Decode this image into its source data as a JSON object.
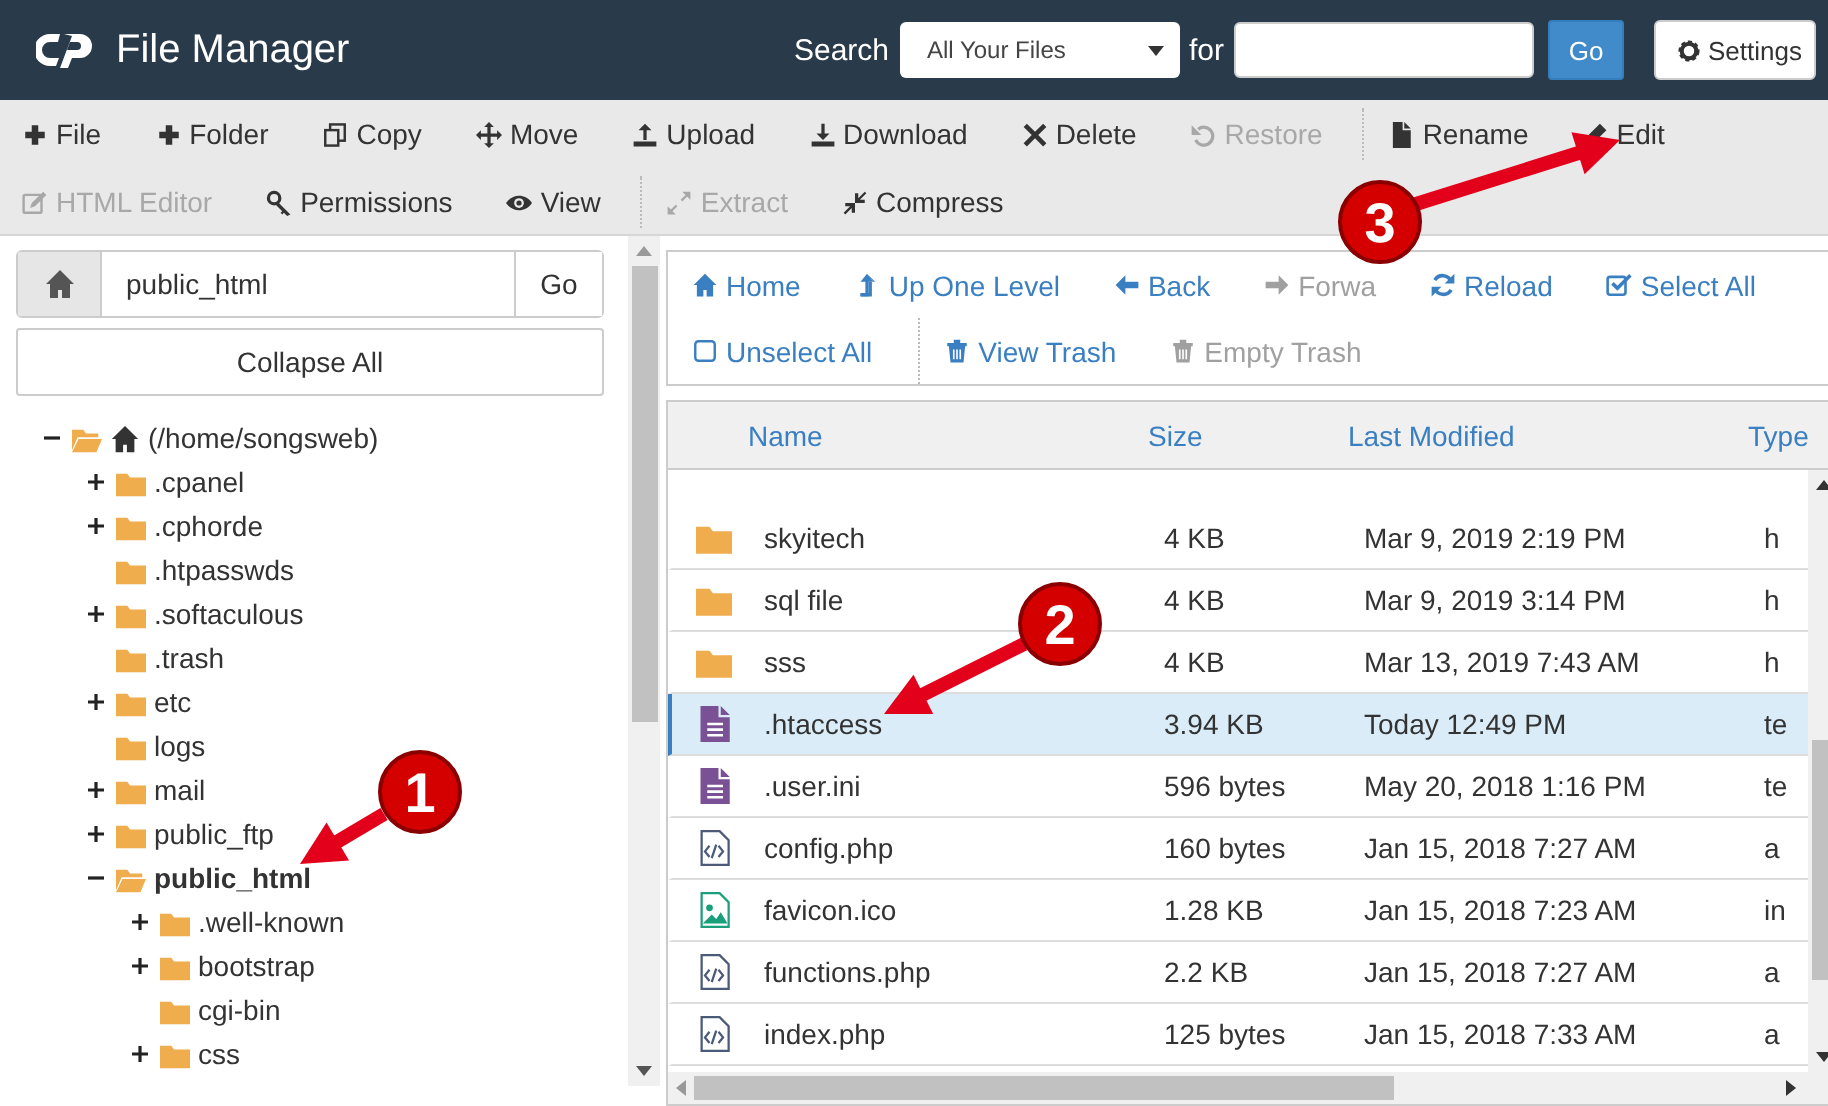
{
  "header": {
    "title": "File Manager",
    "search_label": "Search",
    "search_scope": "All Your Files",
    "for_label": "for",
    "go": "Go",
    "settings": "Settings"
  },
  "toolbar": [
    [
      {
        "label": "File",
        "kind": "plus",
        "disabled": false
      },
      {
        "label": "Folder",
        "kind": "plus",
        "disabled": false
      },
      {
        "label": "Copy",
        "kind": "copy",
        "disabled": false
      },
      {
        "label": "Move",
        "kind": "move",
        "disabled": false
      },
      {
        "label": "Upload",
        "kind": "upload",
        "disabled": false
      },
      {
        "label": "Download",
        "kind": "download",
        "disabled": false
      },
      {
        "label": "Delete",
        "kind": "delete",
        "disabled": false
      },
      {
        "label": "Restore",
        "kind": "restore",
        "disabled": true
      },
      {
        "label": "Rename",
        "kind": "file",
        "disabled": false
      },
      {
        "label": "Edit",
        "kind": "pencil",
        "disabled": false
      }
    ],
    [
      {
        "label": "HTML Editor",
        "kind": "editbox",
        "disabled": true
      },
      {
        "label": "Permissions",
        "kind": "key",
        "disabled": false
      },
      {
        "label": "View",
        "kind": "eye",
        "disabled": false
      },
      {
        "label": "Extract",
        "kind": "expand",
        "disabled": true
      },
      {
        "label": "Compress",
        "kind": "compress",
        "disabled": false
      }
    ]
  ],
  "path_bar": {
    "value": "public_html",
    "go": "Go"
  },
  "collapse_all": "Collapse All",
  "tree": [
    {
      "label": "(/home/songsweb)",
      "kind": "home",
      "expandable": true,
      "expanded": true,
      "selected": false,
      "children": [
        {
          "label": ".cpanel",
          "kind": "folder",
          "expandable": true,
          "expanded": false,
          "selected": false
        },
        {
          "label": ".cphorde",
          "kind": "folder",
          "expandable": true,
          "expanded": false,
          "selected": false
        },
        {
          "label": ".htpasswds",
          "kind": "folder",
          "expandable": false,
          "expanded": false,
          "selected": false
        },
        {
          "label": ".softaculous",
          "kind": "folder",
          "expandable": true,
          "expanded": false,
          "selected": false
        },
        {
          "label": ".trash",
          "kind": "folder",
          "expandable": false,
          "expanded": false,
          "selected": false
        },
        {
          "label": "etc",
          "kind": "folder",
          "expandable": true,
          "expanded": false,
          "selected": false
        },
        {
          "label": "logs",
          "kind": "folder",
          "expandable": false,
          "expanded": false,
          "selected": false
        },
        {
          "label": "mail",
          "kind": "folder",
          "expandable": true,
          "expanded": false,
          "selected": false
        },
        {
          "label": "public_ftp",
          "kind": "folder",
          "expandable": true,
          "expanded": false,
          "selected": false
        },
        {
          "label": "public_html",
          "kind": "folder",
          "expandable": true,
          "expanded": true,
          "selected": true,
          "children": [
            {
              "label": ".well-known",
              "kind": "folder",
              "expandable": true,
              "expanded": false,
              "selected": false
            },
            {
              "label": "bootstrap",
              "kind": "folder",
              "expandable": true,
              "expanded": false,
              "selected": false
            },
            {
              "label": "cgi-bin",
              "kind": "folder",
              "expandable": false,
              "expanded": false,
              "selected": false
            },
            {
              "label": "css",
              "kind": "folder",
              "expandable": true,
              "expanded": false,
              "selected": false
            }
          ]
        }
      ]
    }
  ],
  "nav": [
    [
      {
        "label": "Home",
        "kind": "home",
        "disabled": false
      },
      {
        "label": "Up One Level",
        "kind": "up",
        "disabled": false
      },
      {
        "label": "Back",
        "kind": "left",
        "disabled": false
      },
      {
        "label": "Forwa",
        "kind": "right",
        "disabled": true
      },
      {
        "label": "Reload",
        "kind": "reload",
        "disabled": false
      },
      {
        "label": "Select All",
        "kind": "checked",
        "disabled": false
      }
    ],
    [
      {
        "label": "Unselect All",
        "kind": "square",
        "disabled": false
      },
      {
        "label": "View Trash",
        "kind": "trash",
        "disabled": false
      },
      {
        "label": "Empty Trash",
        "kind": "trash",
        "disabled": true
      }
    ]
  ],
  "table": {
    "columns": [
      "Name",
      "Size",
      "Last Modified",
      "Type"
    ],
    "rows": [
      {
        "kind": "folder",
        "name": "skyitech",
        "size": "4 KB",
        "modified": "Mar 9, 2019 2:19 PM",
        "type": "h",
        "selected": false
      },
      {
        "kind": "folder",
        "name": "sql file",
        "size": "4 KB",
        "modified": "Mar 9, 2019 3:14 PM",
        "type": "h",
        "selected": false
      },
      {
        "kind": "folder",
        "name": "sss",
        "size": "4 KB",
        "modified": "Mar 13, 2019 7:43 AM",
        "type": "h",
        "selected": false
      },
      {
        "kind": "text",
        "name": ".htaccess",
        "size": "3.94 KB",
        "modified": "Today 12:49 PM",
        "type": "te",
        "selected": true
      },
      {
        "kind": "text",
        "name": ".user.ini",
        "size": "596 bytes",
        "modified": "May 20, 2018 1:16 PM",
        "type": "te",
        "selected": false
      },
      {
        "kind": "code",
        "name": "config.php",
        "size": "160 bytes",
        "modified": "Jan 15, 2018 7:27 AM",
        "type": "a",
        "selected": false
      },
      {
        "kind": "image",
        "name": "favicon.ico",
        "size": "1.28 KB",
        "modified": "Jan 15, 2018 7:23 AM",
        "type": "in",
        "selected": false
      },
      {
        "kind": "code",
        "name": "functions.php",
        "size": "2.2 KB",
        "modified": "Jan 15, 2018 7:27 AM",
        "type": "a",
        "selected": false
      },
      {
        "kind": "code",
        "name": "index.php",
        "size": "125 bytes",
        "modified": "Jan 15, 2018 7:33 AM",
        "type": "a",
        "selected": false
      }
    ]
  },
  "callouts": [
    "1",
    "2",
    "3"
  ]
}
